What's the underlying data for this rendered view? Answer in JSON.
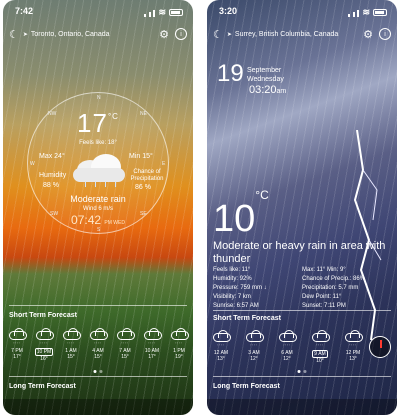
{
  "phones": [
    {
      "time": "7:42",
      "location": "Toronto, Ontario, Canada",
      "temp": "17",
      "unit": "°C",
      "feels_like": "Feels like: 18°",
      "max": "Max 24°",
      "min": "Min 15°",
      "humidity_label": "Humidity",
      "humidity": "88 %",
      "precip_label": "Chance of Precipitation",
      "precip": "86 %",
      "condition": "Moderate rain",
      "wind": "Wind 6 m/s",
      "clock": "07:42",
      "clock_suffix": "PM WED",
      "compass": [
        "N",
        "NE",
        "E",
        "SE",
        "S",
        "SW",
        "W",
        "NW"
      ],
      "short_term_title": "Short Term Forecast",
      "long_term_title": "Long Term Forecast",
      "hourly": [
        {
          "time": "7 PM",
          "temp": "17°",
          "selected": false
        },
        {
          "time": "10 PM",
          "temp": "16°",
          "selected": true
        },
        {
          "time": "1 AM",
          "temp": "15°",
          "selected": false
        },
        {
          "time": "4 AM",
          "temp": "15°",
          "selected": false
        },
        {
          "time": "7 AM",
          "temp": "15°",
          "selected": false
        },
        {
          "time": "10 AM",
          "temp": "17°",
          "selected": false
        },
        {
          "time": "1 PM",
          "temp": "19°",
          "selected": false
        }
      ]
    },
    {
      "time": "3:20",
      "location": "Surrey, British Columbia, Canada",
      "day": "19",
      "month": "September",
      "weekday": "Wednesday",
      "clock": "03:20",
      "clock_suffix": "am",
      "temp": "10",
      "unit": "°C",
      "condition": "Moderate or heavy rain in area with thunder",
      "stats_left": [
        "Feels like: 11°",
        "Humidity: 92%",
        "Pressure: 759 mm ↓",
        "Visibility: 7 km",
        "Sunrise: 6:57 AM"
      ],
      "stats_right": [
        "Max: 11° Min: 9°",
        "Chance of Precip.: 86%",
        "Precipitation: 5.7 mm",
        "Dew Point: 11°",
        "Sunset: 7:11 PM"
      ],
      "short_term_title": "Short Term Forecast",
      "long_term_title": "Long Term Forecast",
      "hourly": [
        {
          "time": "12 AM",
          "temp": "13°",
          "selected": false
        },
        {
          "time": "3 AM",
          "temp": "12°",
          "selected": false
        },
        {
          "time": "6 AM",
          "temp": "12°",
          "selected": false
        },
        {
          "time": "9 AM",
          "temp": "10°",
          "selected": true
        },
        {
          "time": "12 PM",
          "temp": "13°",
          "selected": false
        }
      ]
    }
  ]
}
